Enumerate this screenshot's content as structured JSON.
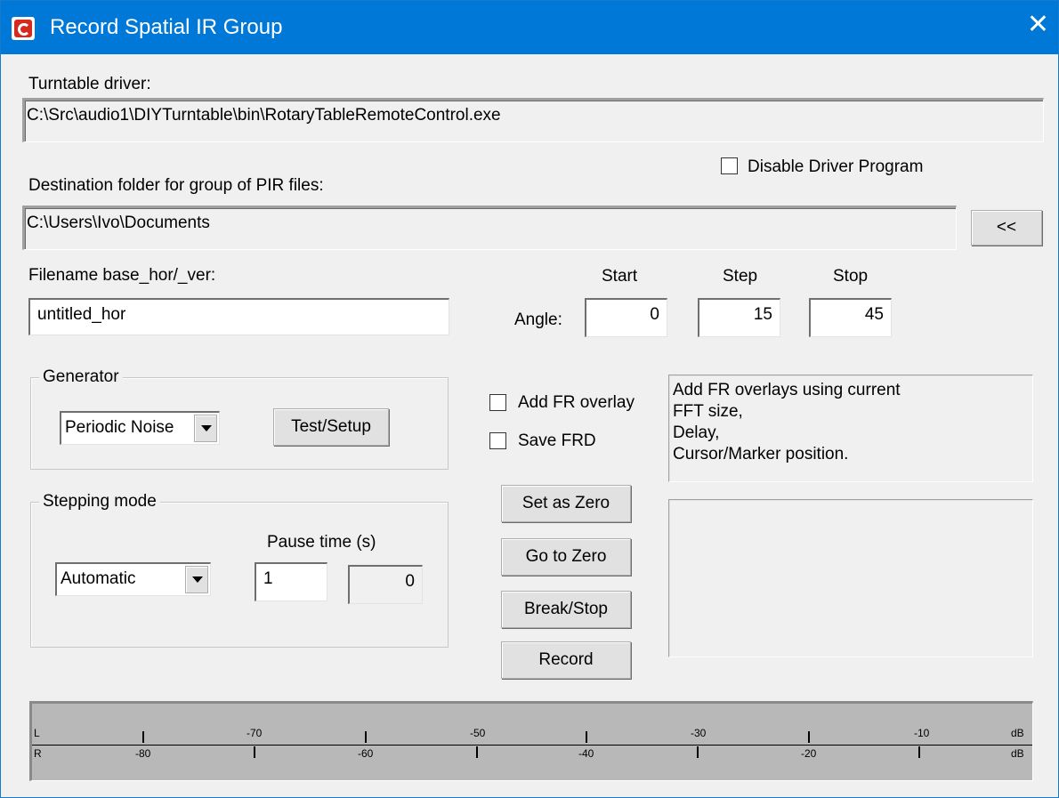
{
  "window": {
    "title": "Record Spatial IR Group",
    "close_glyph": "✕",
    "accent": "#0078d7",
    "logo_color": "#d42a1f"
  },
  "turntable": {
    "label": "Turntable driver:",
    "path": "C:\\Src\\audio1\\DIYTurntable\\bin\\RotaryTableRemoteControl.exe"
  },
  "disable_driver": {
    "label": "Disable Driver Program",
    "checked": false
  },
  "destination": {
    "label": "Destination folder for group of PIR files:",
    "path": "C:\\Users\\Ivo\\Documents",
    "browse_label": "<<"
  },
  "filename": {
    "label": "Filename base_hor/_ver:",
    "value": "untitled_hor"
  },
  "angle": {
    "label": "Angle:",
    "start_label": "Start",
    "step_label": "Step",
    "stop_label": "Stop",
    "start": "0",
    "step": "15",
    "stop": "45"
  },
  "generator": {
    "title": "Generator",
    "selected": "Periodic Noise",
    "test_label": "Test/Setup"
  },
  "options": {
    "add_fr_overlay": "Add FR overlay",
    "save_frd": "Save FRD"
  },
  "info": {
    "lines": [
      "Add FR overlays using current",
      "FFT size,",
      "Delay,",
      "Cursor/Marker position."
    ]
  },
  "stepping": {
    "title": "Stepping mode",
    "selected": "Automatic",
    "pause_label": "Pause time (s)",
    "pause_value": "1",
    "counter_value": "0"
  },
  "actions": {
    "set_zero": "Set as Zero",
    "go_zero": "Go to Zero",
    "break_stop": "Break/Stop",
    "record": "Record"
  },
  "meter": {
    "L_label": "L",
    "R_label": "R",
    "unit": "dB",
    "top_labels": [
      "-70",
      "-50",
      "-30",
      "-10"
    ],
    "bottom_labels": [
      "-80",
      "-60",
      "-40",
      "-20"
    ]
  }
}
